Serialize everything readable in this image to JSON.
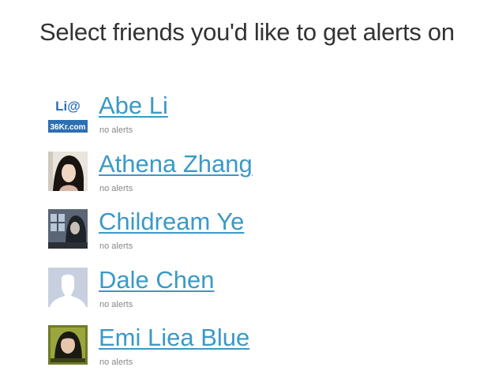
{
  "page": {
    "title": "Select friends you'd like to get alerts on"
  },
  "colors": {
    "link": "#3b99c7",
    "title": "#333333",
    "status": "#888888"
  },
  "friends": [
    {
      "name": "Abe Li",
      "status": "no alerts",
      "avatar": "logo-avatar",
      "avatar_text_top": "Li@",
      "avatar_text_bottom": "36Kr.com"
    },
    {
      "name": "Athena Zhang",
      "status": "no alerts",
      "avatar": "photo-avatar"
    },
    {
      "name": "Childream Ye",
      "status": "no alerts",
      "avatar": "photo-avatar"
    },
    {
      "name": "Dale Chen",
      "status": "no alerts",
      "avatar": "default-silhouette-avatar"
    },
    {
      "name": "Emi Liea Blue",
      "status": "no alerts",
      "avatar": "photo-avatar"
    }
  ]
}
